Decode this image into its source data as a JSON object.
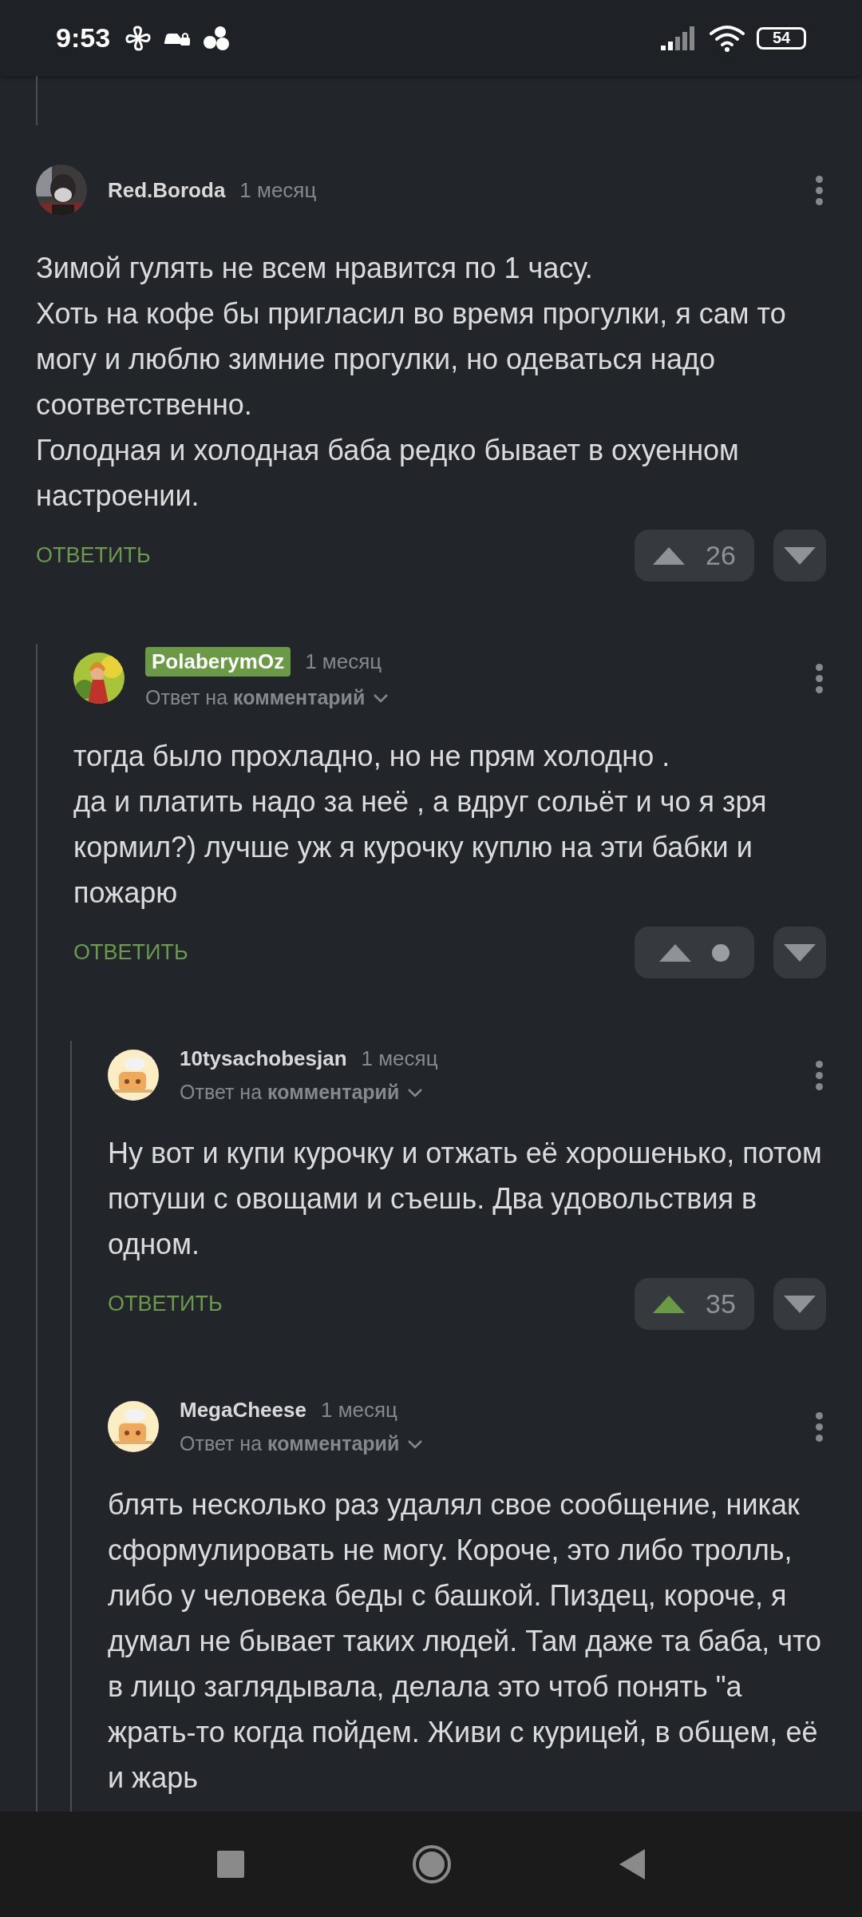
{
  "status_bar": {
    "time": "9:53",
    "battery": "54"
  },
  "comments": [
    {
      "author": "Red.Boroda",
      "badge": false,
      "time": "1 месяц",
      "paragraphs": [
        "Зимой гулять не всем нравится по 1 часу.",
        "Хоть на кофе бы пригласил во время прогулки, я сам то могу и люблю зимние прогулки, но одеваться надо соответственно.",
        "Голодная и холодная баба редко бывает в охуенном настроении."
      ],
      "reply_label": "ОТВЕТИТЬ",
      "vote": {
        "kind": "count",
        "score": "26",
        "upvoted": false
      },
      "children": [
        {
          "author": "PolaberymOz",
          "badge": true,
          "time": "1 месяц",
          "reply_to": {
            "prefix": "Ответ на",
            "target": "комментарий"
          },
          "paragraphs": [
            "тогда было прохладно, но не прям холодно .",
            "да и платить надо за неё , а вдруг сольёт и чо я зря кормил?) лучше уж я курочку куплю на эти бабки и пожарю"
          ],
          "reply_label": "ОТВЕТИТЬ",
          "vote": {
            "kind": "hidden",
            "upvoted": false
          },
          "children": [
            {
              "author": "10tysachobesjan",
              "badge": false,
              "time": "1 месяц",
              "reply_to": {
                "prefix": "Ответ на",
                "target": "комментарий"
              },
              "paragraphs": [
                "Ну вот и купи курочку и отжать её хорошенько, потом потуши с овощами и съешь. Два удовольствия в одном."
              ],
              "reply_label": "ОТВЕТИТЬ",
              "vote": {
                "kind": "count",
                "score": "35",
                "upvoted": true
              }
            },
            {
              "author": "MegaCheese",
              "badge": false,
              "time": "1 месяц",
              "reply_to": {
                "prefix": "Ответ на",
                "target": "комментарий"
              },
              "paragraphs": [
                "блять несколько раз удалял свое сообщение, никак сформулировать не могу. Короче, это либо тролль, либо у человека беды с башкой. Пиздец, короче, я думал не бывает таких людей. Там даже та баба, что в лицо заглядывала, делала это чтоб понять \"а жрать-то когда пойдем. Живи с курицей, в общем, её и жарь"
              ]
            }
          ]
        }
      ]
    }
  ]
}
